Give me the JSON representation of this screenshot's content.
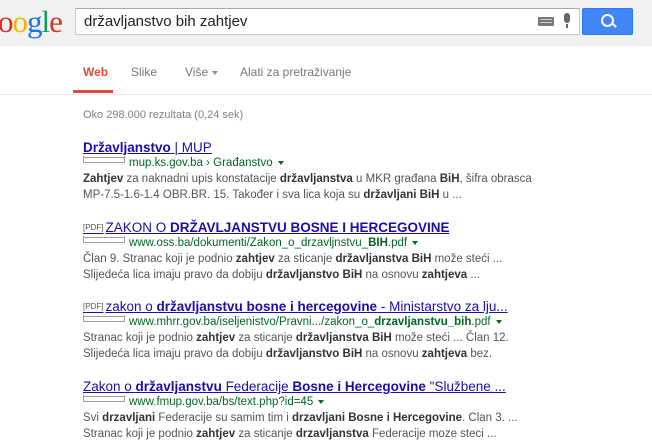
{
  "logo": {
    "text": "oogle"
  },
  "search": {
    "query": "državljanstvo bih zahtjev"
  },
  "nav": {
    "tabs": [
      {
        "label": "Web",
        "active": true
      },
      {
        "label": "Slike"
      },
      {
        "label": "Više"
      },
      {
        "label": "Alati za pretraživanje"
      }
    ]
  },
  "stats": "Oko 298.000 rezultata (0,24 sek)",
  "results": [
    {
      "title_parts": [
        "Državljanstvo",
        " | MUP"
      ],
      "url": "mup.ks.gov.ba › Građanstvo",
      "snippet_lines": [
        [
          "Zahtjev",
          " za naknadni upis konstatacije ",
          "državljanstva",
          " u MKR građana ",
          "BiH",
          ", šifra obrasca"
        ],
        [
          "MP-7.5-1.6-1.4 OBR.BR. 15. Također i sva lica koja su ",
          "državljani BiH",
          " u ..."
        ]
      ]
    },
    {
      "pdf": "[PDF]",
      "title_parts": [
        "ZAKON O ",
        "DRŽAVLJANSTVU BOSNE I HERCEGOVINE"
      ],
      "url_parts": [
        "www.oss.ba/dokumenti/Zakon_o_drzavljnstvu_",
        "BIH",
        ".pdf"
      ],
      "snippet_lines": [
        [
          "Član 9. Stranac koji je podnio ",
          "zahtjev",
          " za sticanje ",
          "državljanstva BiH",
          " može steći ..."
        ],
        [
          "Slijedeća lica imaju pravo da dobiju ",
          "državljanstvo BiH",
          " na osnovu ",
          "zahtjeva",
          " ..."
        ]
      ]
    },
    {
      "pdf": "[PDF]",
      "title_parts": [
        "zakon o ",
        "državljanstvu bosne i hercegovine",
        " - Ministarstvo za lju..."
      ],
      "url_parts": [
        "www.mhrr.gov.ba/iseljenistvo/Pravni.../zakon_o_",
        "drzavljanstvu_bih",
        ".pdf"
      ],
      "snippet_lines": [
        [
          "Stranac koji je podnio ",
          "zahtjev",
          " za sticanje ",
          "državljanstva BiH",
          " može steći ... Član 12."
        ],
        [
          "Slijedeća lica imaju pravo da dobiju ",
          "državljanstvo BiH",
          " na osnovu ",
          "zahtjeva",
          " bez."
        ]
      ]
    },
    {
      "title_parts": [
        "Zakon o ",
        "državljanstvu",
        " Federacije ",
        "Bosne i Hercegovine",
        " \"Službene ..."
      ],
      "url": "www.fmup.gov.ba/bs/text.php?id=45",
      "snippet_lines": [
        [
          "Svi ",
          "drzavljani",
          " Federacije su samim tim i ",
          "drzavljani Bosne i Hercegovine",
          ". Clan 3. ..."
        ],
        [
          "Stranac koji je podnio ",
          "zahtjev",
          " za sticanje ",
          "drzavljanstva",
          " Federacije moze steci ..."
        ]
      ]
    }
  ]
}
